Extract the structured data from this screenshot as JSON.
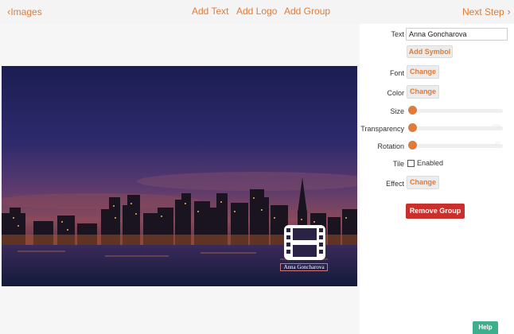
{
  "nav": {
    "back": "Images",
    "add_text": "Add Text",
    "add_logo": "Add Logo",
    "add_group": "Add Group",
    "next": "Next Step"
  },
  "panel": {
    "text_label": "Text",
    "text_value": "Anna Goncharova",
    "add_symbol": "Add Symbol",
    "font_label": "Font",
    "font_button": "Change",
    "color_label": "Color",
    "color_button": "Change",
    "size_label": "Size",
    "size_value": 0,
    "transparency_label": "Transparency",
    "transparency_value": 0,
    "transparency_readout": "0%",
    "rotation_label": "Rotation",
    "rotation_value": 0,
    "rotation_readout": "0°",
    "tile_label": "Tile",
    "tile_checkbox": "Enabled",
    "tile_enabled": false,
    "effect_label": "Effect",
    "effect_button": "Change",
    "remove_group": "Remove Group"
  },
  "watermark": {
    "symbol": "film-icon",
    "caption": "Anna Goncharova"
  },
  "help": "Help",
  "colors": {
    "accent": "#e07b39",
    "danger": "#c9302c",
    "help": "#3fae8c"
  }
}
